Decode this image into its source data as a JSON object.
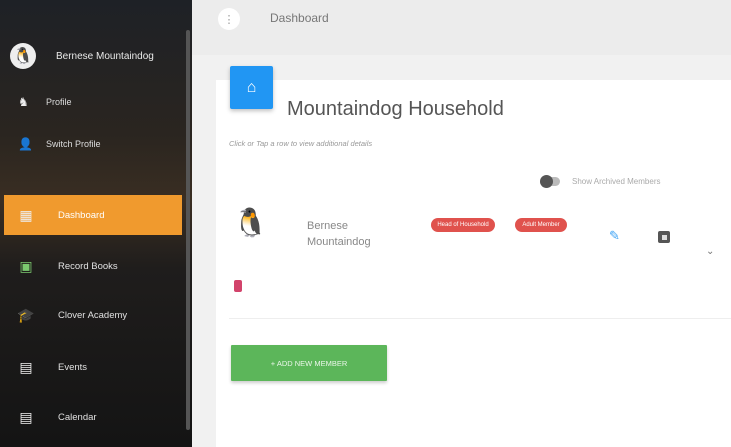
{
  "sidebar": {
    "user_name": "Bernese Mountaindog",
    "profile_label": "Profile",
    "switch_profile_label": "Switch Profile",
    "items": [
      {
        "label": "Dashboard",
        "icon": "dashboard-icon",
        "active": true
      },
      {
        "label": "Record Books",
        "icon": "record-book-icon"
      },
      {
        "label": "Clover Academy",
        "icon": "graduation-cap-icon"
      },
      {
        "label": "Events",
        "icon": "calendar-icon"
      },
      {
        "label": "Calendar",
        "icon": "calendar-icon"
      }
    ]
  },
  "header": {
    "breadcrumb": "Dashboard"
  },
  "main": {
    "household_title": "Mountaindog Household",
    "hint": "Click or Tap a row to view additional details",
    "show_archived_label": "Show Archived Members",
    "member": {
      "name": "Bernese Mountaindog",
      "badges": [
        "Head of Household",
        "Adult Member"
      ]
    },
    "add_button_label": "+ ADD NEW MEMBER"
  },
  "colors": {
    "active_nav": "#f09a2e",
    "home_button": "#2196f3",
    "badge": "#e0524d",
    "add_button": "#5cb65a"
  }
}
